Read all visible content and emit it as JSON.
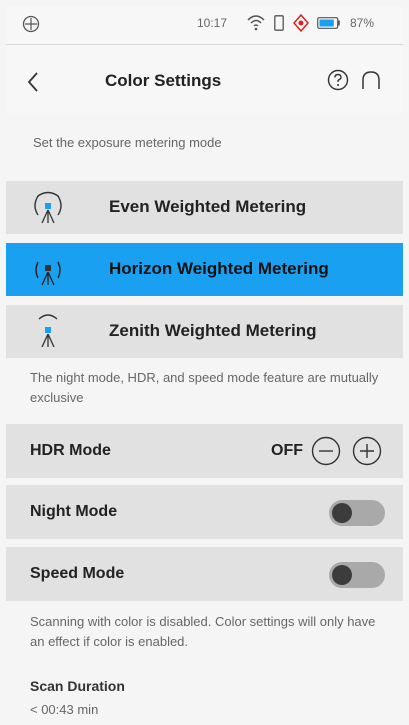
{
  "status_bar": {
    "time": "10:17",
    "battery": "87%",
    "battery_level": 0.87
  },
  "header": {
    "title": "Color Settings"
  },
  "metering": {
    "hint": "Set the exposure metering mode",
    "options": [
      {
        "label": "Even Weighted Metering",
        "selected": false
      },
      {
        "label": "Horizon Weighted Metering",
        "selected": true
      },
      {
        "label": "Zenith Weighted Metering",
        "selected": false
      }
    ]
  },
  "modes": {
    "note": "The night mode, HDR, and speed mode feature are mutually exclusive",
    "hdr": {
      "label": "HDR Mode",
      "value": "OFF"
    },
    "night": {
      "label": "Night Mode",
      "on": false
    },
    "speed": {
      "label": "Speed Mode",
      "on": false
    }
  },
  "scan": {
    "note": "Scanning with color is disabled. Color settings will only have an effect if color is enabled.",
    "duration_label": "Scan Duration",
    "duration_value": "< 00:43 min"
  },
  "colors": {
    "accent": "#1aa0f0",
    "row_bg": "#e1e1e1",
    "toggle_track": "#a9a9a9",
    "toggle_knob": "#3c3c3c"
  },
  "icons": [
    "app-icon",
    "wifi-icon",
    "phone-icon",
    "gps-icon",
    "battery-icon",
    "back-icon",
    "help-icon",
    "home-icon",
    "tripod-icon",
    "minus-icon",
    "plus-icon"
  ]
}
